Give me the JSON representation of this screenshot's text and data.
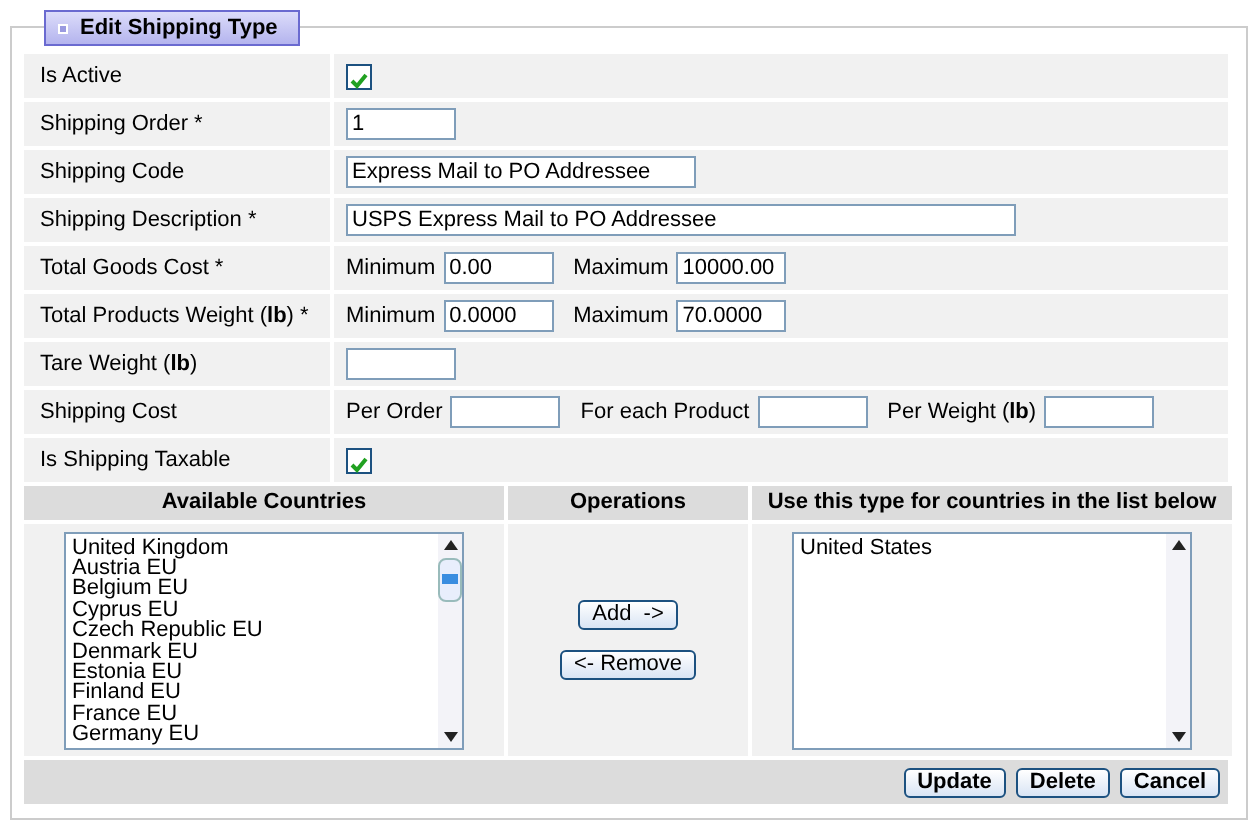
{
  "legend": "Edit Shipping Type",
  "fields": [
    {
      "label": "Is Active",
      "kind": "checkbox",
      "checked": true
    },
    {
      "label": "Shipping Order *",
      "kind": "text-short",
      "value": "1"
    },
    {
      "label": "Shipping Code",
      "kind": "text-medium",
      "value": "Express Mail to PO Addressee"
    },
    {
      "label": "Shipping Description *",
      "kind": "text-long",
      "value": "USPS Express Mail to PO Addressee"
    },
    {
      "label": "Total Goods Cost *",
      "kind": "inputs",
      "parts": [
        {
          "label": "Minimum",
          "value": "0.00"
        },
        {
          "label": "Maximum",
          "value": "10000.00"
        }
      ]
    },
    {
      "label": "Total Products Weight (**lb**) *",
      "kind": "inputs",
      "parts": [
        {
          "label": "Minimum",
          "value": "0.0000"
        },
        {
          "label": "Maximum",
          "value": "70.0000"
        }
      ]
    },
    {
      "label": "Tare Weight (**lb**)",
      "kind": "text-short"
    },
    {
      "label": "Shipping Cost",
      "kind": "inputs",
      "parts": [
        {
          "label": "Per Order"
        },
        {
          "label": "For each Product"
        },
        {
          "label": "Per Weight (**lb**)"
        }
      ]
    },
    {
      "label": "Is Shipping Taxable",
      "kind": "checkbox",
      "checked": true
    }
  ],
  "countries": {
    "available": {
      "heading": "Available Countries",
      "items": [
        "United Kingdom",
        "Austria EU",
        "Belgium EU",
        "Cyprus EU",
        "Czech Republic EU",
        "Denmark EU",
        "Estonia EU",
        "Finland EU",
        "France EU",
        "Germany EU"
      ]
    },
    "operations": {
      "heading": "Operations",
      "buttons": [
        "Add  ->",
        "<- Remove"
      ]
    },
    "selected": {
      "heading": "Use this type for countries in the list below",
      "items": [
        "United States"
      ]
    }
  },
  "buttons": [
    "Update",
    "Delete",
    "Cancel"
  ]
}
